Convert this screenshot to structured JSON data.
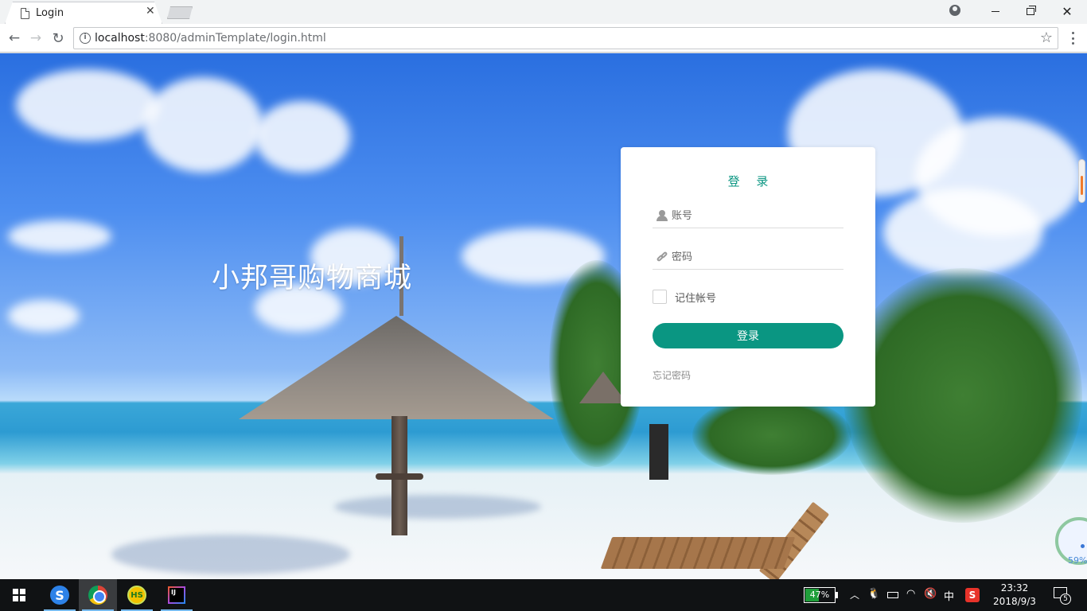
{
  "browser": {
    "tab": {
      "title": "Login",
      "favicon_icon": "page-icon",
      "close_icon": "close-icon"
    },
    "window_controls": {
      "profile_icon": "profile-icon"
    },
    "address": {
      "host": "localhost",
      "rest": ":8080/adminTemplate/login.html"
    }
  },
  "page": {
    "brand_title": "小邦哥购物商城",
    "login": {
      "heading": "登 录",
      "username_placeholder": "账号",
      "password_placeholder": "密码",
      "remember_label": "记住帐号",
      "remember_checked": false,
      "submit_label": "登录",
      "forgot_label": "忘记密码",
      "accent_color": "#0a9682"
    },
    "speed_widget": {
      "percent": "59%"
    }
  },
  "taskbar": {
    "apps": [
      "sogou-browser-icon",
      "chrome-icon",
      "hs-icon",
      "intellij-idea-icon"
    ],
    "idea_label": "IJ",
    "hs_label": "HS",
    "battery": {
      "percent_text": "47%",
      "level": 0.47
    },
    "ime": "中",
    "sogou_ime": "S",
    "clock": {
      "time": "23:32",
      "date": "2018/9/3"
    },
    "notifications": "5"
  }
}
